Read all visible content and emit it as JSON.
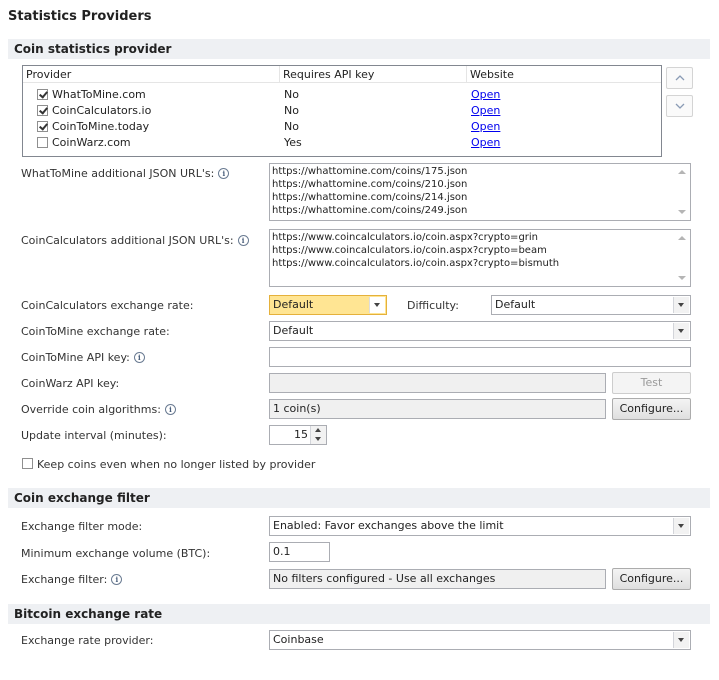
{
  "page_title": "Statistics Providers",
  "sections": {
    "coin_stats": "Coin statistics provider",
    "exchange_filter": "Coin exchange filter",
    "bitcoin_rate": "Bitcoin exchange rate"
  },
  "providers_grid": {
    "columns": [
      "Provider",
      "Requires API key",
      "Website"
    ],
    "rows": [
      {
        "name": "WhatToMine.com",
        "checked": true,
        "requires_api_key": "No",
        "website": "Open"
      },
      {
        "name": "CoinCalculators.io",
        "checked": true,
        "requires_api_key": "No",
        "website": "Open"
      },
      {
        "name": "CoinToMine.today",
        "checked": true,
        "requires_api_key": "No",
        "website": "Open"
      },
      {
        "name": "CoinWarz.com",
        "checked": false,
        "requires_api_key": "Yes",
        "website": "Open"
      }
    ]
  },
  "wtm_urls": {
    "label": "WhatToMine additional JSON URL's:",
    "lines": [
      "https://whattomine.com/coins/175.json",
      "https://whattomine.com/coins/210.json",
      "https://whattomine.com/coins/214.json",
      "https://whattomine.com/coins/249.json"
    ]
  },
  "cc_urls": {
    "label": "CoinCalculators additional JSON URL's:",
    "lines": [
      "https://www.coincalculators.io/coin.aspx?crypto=grin",
      "https://www.coincalculators.io/coin.aspx?crypto=beam",
      "https://www.coincalculators.io/coin.aspx?crypto=bismuth"
    ]
  },
  "cc_exchange_rate": {
    "label": "CoinCalculators exchange rate:",
    "value": "Default"
  },
  "difficulty": {
    "label": "Difficulty:",
    "value": "Default"
  },
  "ctm_exchange_rate": {
    "label": "CoinToMine exchange rate:",
    "value": "Default"
  },
  "ctm_api_key": {
    "label": "CoinToMine API key:",
    "value": ""
  },
  "cw_api_key": {
    "label": "CoinWarz API key:",
    "value": "",
    "test_label": "Test"
  },
  "override_algos": {
    "label": "Override coin algorithms:",
    "value": "1 coin(s)",
    "configure_label": "Configure..."
  },
  "update_interval": {
    "label": "Update interval (minutes):",
    "value": "15"
  },
  "keep_coins": {
    "label": "Keep coins even when no longer listed by provider",
    "checked": false
  },
  "exchange_filter_mode": {
    "label": "Exchange filter mode:",
    "value": "Enabled: Favor exchanges above the limit"
  },
  "min_exchange_volume": {
    "label": "Minimum exchange volume (BTC):",
    "value": "0.1"
  },
  "exchange_filter": {
    "label": "Exchange filter:",
    "value": "No filters configured - Use all exchanges",
    "configure_label": "Configure..."
  },
  "rate_provider": {
    "label": "Exchange rate provider:",
    "value": "Coinbase"
  }
}
